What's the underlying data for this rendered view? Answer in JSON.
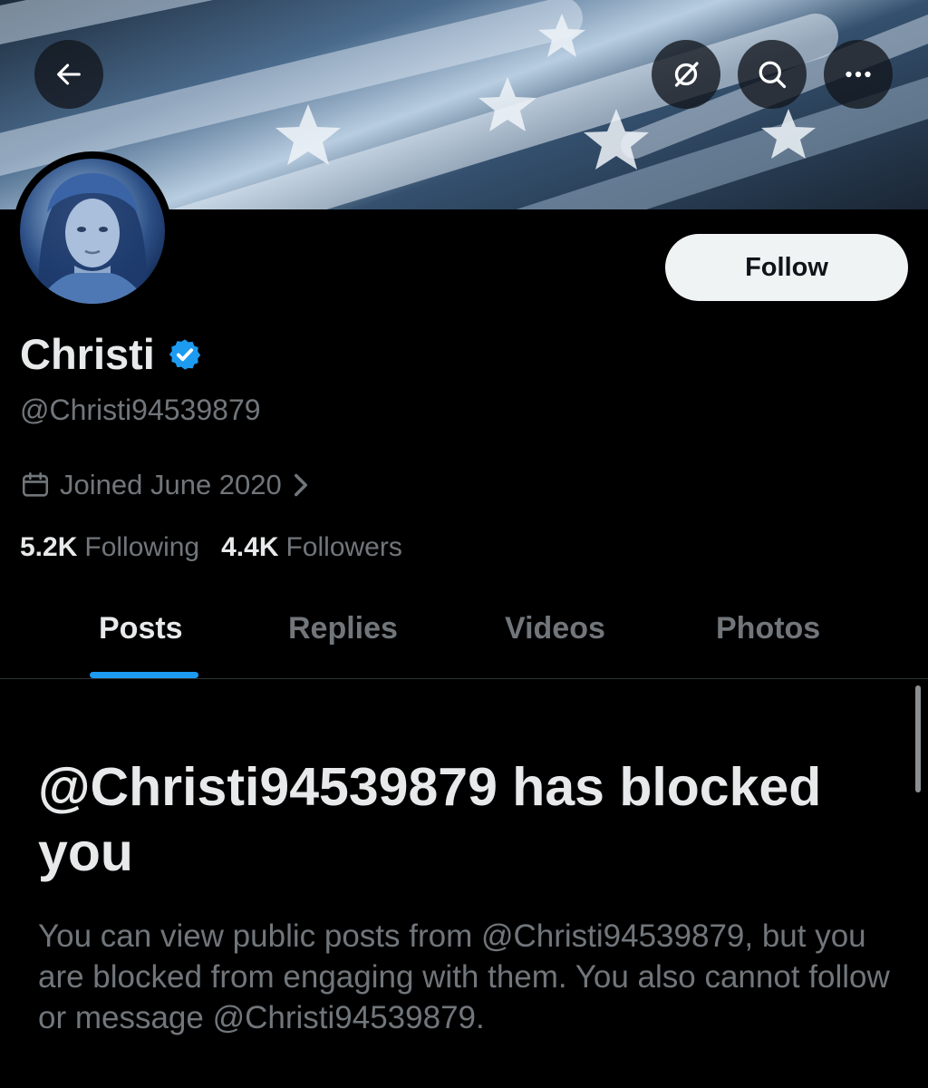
{
  "header": {
    "back_icon": "arrow-left-icon",
    "grok_icon": "slashed-circle-icon",
    "search_icon": "search-icon",
    "more_icon": "more-horizontal-icon"
  },
  "profile": {
    "display_name": "Christi",
    "handle": "@Christi94539879",
    "verified": true,
    "joined": "Joined June 2020",
    "follow_label": "Follow",
    "following_count": "5.2K",
    "following_label": "Following",
    "followers_count": "4.4K",
    "followers_label": "Followers"
  },
  "tabs": [
    {
      "label": "Posts",
      "active": true
    },
    {
      "label": "Replies",
      "active": false
    },
    {
      "label": "Videos",
      "active": false
    },
    {
      "label": "Photos",
      "active": false
    }
  ],
  "blocked": {
    "title": "@Christi94539879 has blocked you",
    "description": "You can view public posts from @Christi94539879, but you are blocked from engaging with them. You also cannot follow or message @Christi94539879."
  },
  "colors": {
    "accent": "#1d9bf0",
    "verified": "#1d9bf0",
    "secondary_text": "#71767b",
    "primary_text": "#e7e9ea",
    "background": "#000000"
  }
}
